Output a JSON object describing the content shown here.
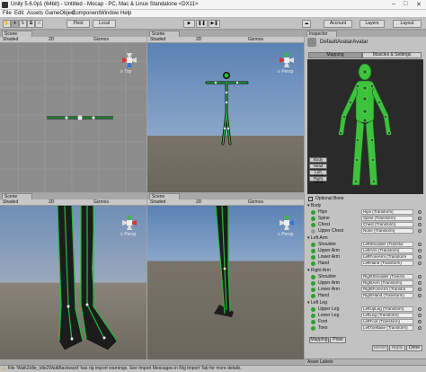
{
  "window": {
    "title": "Unity 5.6.0p1 (64bit) - Untitled - Mocap - PC, Mac & Linux Standalone <DX11>"
  },
  "menu": [
    "File",
    "Edit",
    "Assets",
    "GameObject",
    "Component",
    "Window",
    "Help"
  ],
  "toolbar": {
    "pivot": "Pivot",
    "local": "Local",
    "account": "Account",
    "layers": "Layers",
    "layout": "Layout"
  },
  "scenes": [
    {
      "tab": "Scene",
      "shading": "Shaded",
      "mode": "2D",
      "gizmos": "Gizmos",
      "view": "Top"
    },
    {
      "tab": "Scene",
      "shading": "Shaded",
      "mode": "2D",
      "gizmos": "Gizmos",
      "view": "Persp"
    },
    {
      "tab": "Scene",
      "shading": "Shaded",
      "mode": "2D",
      "gizmos": "Gizmos",
      "view": "Persp"
    },
    {
      "tab": "Scene",
      "shading": "Shaded",
      "mode": "2D",
      "gizmos": "Gizmos",
      "view": "Persp"
    }
  ],
  "inspector": {
    "tab": "Inspector",
    "object": "DefaultAvatarAvatar",
    "tabs": [
      "Mapping",
      "Muscles & Settings"
    ],
    "parts": [
      "Body",
      "Head",
      "Left Hand",
      "Right Hand"
    ],
    "optional_bone": "Optional Bone",
    "groups": [
      {
        "name": "Body",
        "bones": [
          {
            "label": "Hips",
            "value": "Hips (Transform)"
          },
          {
            "label": "Spine",
            "value": "Spine (Transform)"
          },
          {
            "label": "Chest",
            "value": "Chest (Transform)"
          },
          {
            "label": "Upper Chest",
            "value": "None (Transform)"
          }
        ]
      },
      {
        "name": "Left Arm",
        "bones": [
          {
            "label": "Shoulder",
            "value": "LeftShoulder (Transfor"
          },
          {
            "label": "Upper Arm",
            "value": "LeftArm (Transform)"
          },
          {
            "label": "Lower Arm",
            "value": "LeftForeArm (Transform"
          },
          {
            "label": "Hand",
            "value": "LeftHand (Transform)"
          }
        ]
      },
      {
        "name": "Right Arm",
        "bones": [
          {
            "label": "Shoulder",
            "value": "RightShoulder (Transfo"
          },
          {
            "label": "Upper Arm",
            "value": "RightArm (Transform)"
          },
          {
            "label": "Lower Arm",
            "value": "RightForeArm (Transfor"
          },
          {
            "label": "Hand",
            "value": "RightHand (Transform)"
          }
        ]
      },
      {
        "name": "Left Leg",
        "bones": [
          {
            "label": "Upper Leg",
            "value": "LeftUpLeg (Transform)"
          },
          {
            "label": "Lower Leg",
            "value": "LeftLeg (Transform)"
          },
          {
            "label": "Foot",
            "value": "LeftFoot (Transform)"
          },
          {
            "label": "Toes",
            "value": "LeftToeBase (Transform)"
          }
        ]
      }
    ],
    "bottom_left": [
      "Mapping",
      "Pose"
    ],
    "bottom_right": [
      "Revert",
      "Apply",
      "Done"
    ],
    "asset_labels": "Asset Labels"
  },
  "status": "File 'Walk2Idle_Idle2WalkBackward' has rig import warnings. See Import Messages in Rig Import Tab for more details.",
  "colors": {
    "sky": "#5b82b4",
    "ground": "#6b655c",
    "skeleton": "#1a8a2a",
    "bone_dot": "#2ea02e"
  }
}
